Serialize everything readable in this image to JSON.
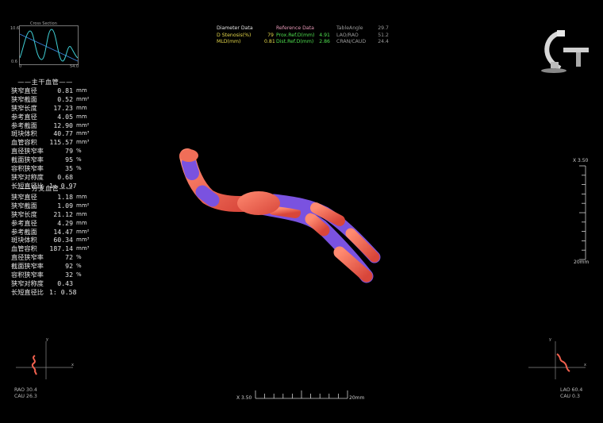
{
  "cross_section": {
    "title": "Cross Section",
    "y_top": "10.6",
    "y_bottom": "0.6",
    "x_left": "0",
    "x_right": "54.0"
  },
  "main_vessel": {
    "title": "主干血管",
    "rows": [
      {
        "label": "狭窄直径",
        "value": "0.81",
        "unit": "mm"
      },
      {
        "label": "狭窄截面",
        "value": "0.52",
        "unit": "mm²"
      },
      {
        "label": "狭窄长度",
        "value": "17.23",
        "unit": "mm"
      },
      {
        "label": "参考直径",
        "value": "4.05",
        "unit": "mm"
      },
      {
        "label": "参考截面",
        "value": "12.90",
        "unit": "mm²"
      },
      {
        "label": "斑块体积",
        "value": "40.77",
        "unit": "mm³"
      },
      {
        "label": "血管容积",
        "value": "115.57",
        "unit": "mm³"
      },
      {
        "label": "直径狭窄率",
        "value": "79",
        "unit": "%"
      },
      {
        "label": "截面狭窄率",
        "value": "95",
        "unit": "%"
      },
      {
        "label": "容积狭窄率",
        "value": "35",
        "unit": "%"
      },
      {
        "label": "狭窄对称度",
        "value": "0.68",
        "unit": ""
      },
      {
        "label": "长短直径比",
        "value": "1: 0.97",
        "unit": ""
      }
    ]
  },
  "branch_vessel": {
    "title": "分支血管",
    "rows": [
      {
        "label": "狭窄直径",
        "value": "1.18",
        "unit": "mm"
      },
      {
        "label": "狭窄截面",
        "value": "1.09",
        "unit": "mm²"
      },
      {
        "label": "狭窄长度",
        "value": "21.12",
        "unit": "mm"
      },
      {
        "label": "参考直径",
        "value": "4.29",
        "unit": "mm"
      },
      {
        "label": "参考截面",
        "value": "14.47",
        "unit": "mm²"
      },
      {
        "label": "斑块体积",
        "value": "60.34",
        "unit": "mm³"
      },
      {
        "label": "血管容积",
        "value": "187.14",
        "unit": "mm³"
      },
      {
        "label": "直径狭窄率",
        "value": "72",
        "unit": "%"
      },
      {
        "label": "截面狭窄率",
        "value": "92",
        "unit": "%"
      },
      {
        "label": "容积狭窄率",
        "value": "32",
        "unit": "%"
      },
      {
        "label": "狭窄对称度",
        "value": "0.43",
        "unit": ""
      },
      {
        "label": "长短直径比",
        "value": "1: 0.58",
        "unit": ""
      }
    ]
  },
  "diameter_data": {
    "title": "Diameter Data",
    "stenosis_label": "D Stenosis(%)",
    "stenosis_value": "79",
    "mld_label": "MLD(mm)",
    "mld_value": "0.81"
  },
  "reference_data": {
    "title": "Reference Data",
    "prox_label": "Prox.Ref.D(mm)",
    "prox_value": "4.91",
    "dist_label": "Dist.Ref.D(mm)",
    "dist_value": "2.86"
  },
  "angles": {
    "table_label": "TableAngle",
    "table_value": "29.7",
    "lao_rao_label": "LAO/RAO",
    "lao_rao_value": "51.2",
    "cran_caud_label": "CRAN/CAUD",
    "cran_caud_value": "24.4"
  },
  "scale_right": {
    "top_label": "X 3.50",
    "bottom_label": "20mm"
  },
  "scale_bottom": {
    "left_label": "X 3.50",
    "right_label": "20mm"
  },
  "bottom_left": {
    "line1": "RAO 30.4",
    "line2": "CAU 26.3",
    "axis_x": "x",
    "axis_y": "y"
  },
  "bottom_right": {
    "line1": "LAO 60.4",
    "line2": "CAU 0.3",
    "axis_x": "x",
    "axis_y": "y"
  },
  "colors": {
    "background": "#000000",
    "vessel_red": "#f0604e",
    "vessel_purple": "#7a52e0",
    "curve_cyan": "#3fd0d6",
    "fit_line": "#3a7fd6",
    "yellow_text": "#e6d84a",
    "green_text": "#4fe04f",
    "pink_text": "#e89ab8"
  },
  "icons": [
    "c-arm-gantry-icon",
    "orientation-axes-icon"
  ]
}
